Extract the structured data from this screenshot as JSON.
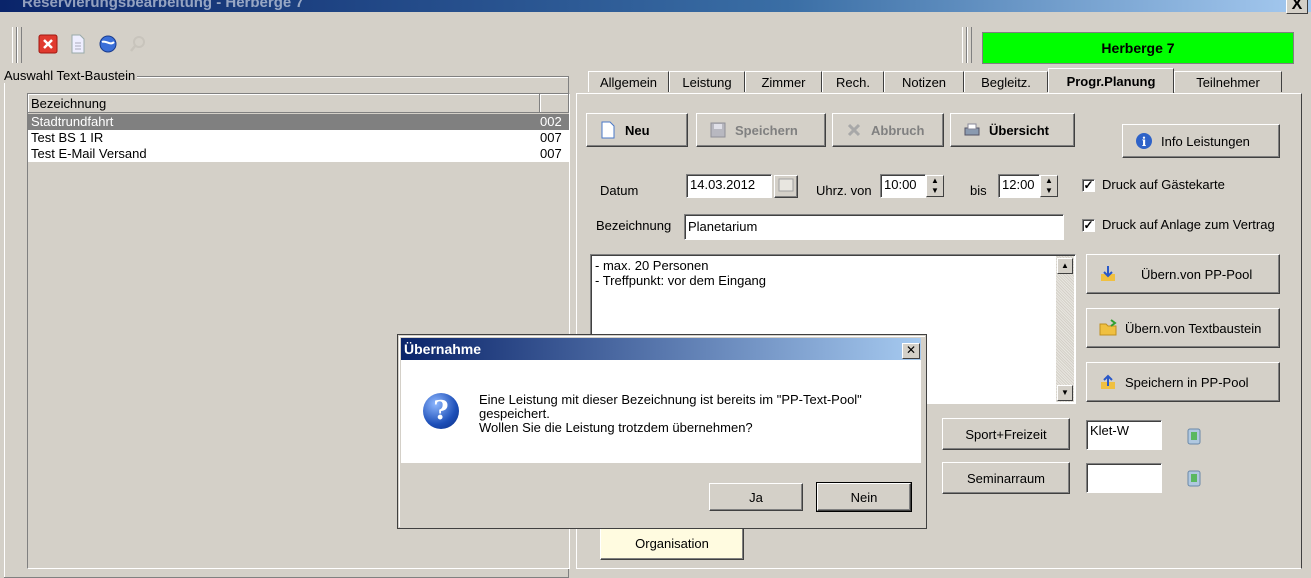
{
  "window": {
    "title": "Reservierungsbearbeitung - Herberge 7",
    "close": "X"
  },
  "toolbar": {
    "icons": [
      "close-red-icon",
      "document-icon",
      "globe-icon",
      "search-icon"
    ]
  },
  "hostel_label": "Herberge 7",
  "left_panel": {
    "group_label": "Auswahl Text-Baustein",
    "columns": [
      "Bezeichnung",
      ""
    ],
    "rows": [
      {
        "name": "Stadtrundfahrt",
        "code": "002"
      },
      {
        "name": "Test BS 1 IR",
        "code": "007"
      },
      {
        "name": "Test E-Mail Versand",
        "code": "007"
      }
    ]
  },
  "tabs": [
    {
      "label": "Allgemein",
      "active": false
    },
    {
      "label": "Leistung",
      "active": false
    },
    {
      "label": "Zimmer",
      "active": false
    },
    {
      "label": "Rech.",
      "active": false
    },
    {
      "label": "Notizen",
      "active": false
    },
    {
      "label": "Begleitz.",
      "active": false
    },
    {
      "label": "Progr.Planung",
      "active": true
    },
    {
      "label": "Teilnehmer",
      "active": false
    }
  ],
  "form": {
    "buttons": {
      "new": "Neu",
      "save": "Speichern",
      "cancel": "Abbruch",
      "overview": "Übersicht",
      "info": "Info Leistungen"
    },
    "date_label": "Datum",
    "date_value": "14.03.2012",
    "time_from_label": "Uhrz. von",
    "time_from": "10:00",
    "time_to_label": "bis",
    "time_to": "12:00",
    "print_guest_card": "Druck auf Gästekarte",
    "print_contract": "Druck auf Anlage zum Vertrag",
    "title_label": "Bezeichnung",
    "title_value": "Planetarium",
    "memo_line1": "- max. 20 Personen",
    "memo_line2": "- Treffpunkt: vor dem Eingang",
    "pool_from": "Übern.von PP-Pool",
    "from_textblock": "Übern.von Textbaustein",
    "save_pool": "Speichern in PP-Pool",
    "sport_button": "Sport+Freizeit",
    "sport_value": "Klet-W",
    "seminar_button": "Seminarraum",
    "seminar_value": "",
    "organisation_button": "Organisation"
  },
  "dialog": {
    "title": "Übernahme",
    "line1": "Eine Leistung mit dieser Bezeichnung ist bereits im \"PP-Text-Pool\"",
    "line2": "gespeichert.",
    "line3": "Wollen Sie die Leistung trotzdem übernehmen?",
    "yes": "Ja",
    "no": "Nein"
  }
}
